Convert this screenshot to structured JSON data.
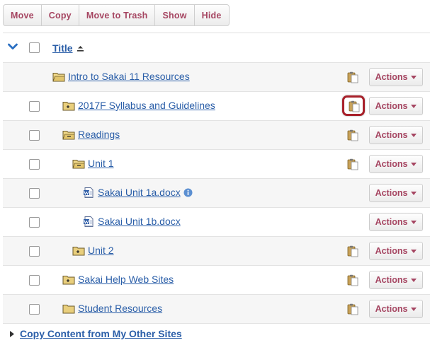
{
  "toolbar": {
    "buttons": [
      "Move",
      "Copy",
      "Move to Trash",
      "Show",
      "Hide"
    ]
  },
  "header": {
    "title_label": "Title"
  },
  "rows": [
    {
      "name": "Intro to Sakai 11 Resources",
      "icon": "folder-open-icon",
      "indent": 0,
      "has_checkbox": false,
      "has_clipboard": true,
      "actions": "Actions"
    },
    {
      "name": "2017F Syllabus and Guidelines",
      "icon": "folder-plus-icon",
      "indent": 1,
      "has_checkbox": true,
      "has_clipboard": true,
      "clipboard_highlighted": true,
      "actions": "Actions"
    },
    {
      "name": "Readings",
      "icon": "folder-minus-icon",
      "indent": 1,
      "has_checkbox": true,
      "has_clipboard": true,
      "actions": "Actions"
    },
    {
      "name": "Unit 1",
      "icon": "folder-minus-icon",
      "indent": 2,
      "has_checkbox": true,
      "has_clipboard": true,
      "actions": "Actions"
    },
    {
      "name": "Sakai Unit 1a.docx",
      "icon": "word-doc-icon",
      "indent": 3,
      "has_checkbox": true,
      "has_clipboard": false,
      "has_info": true,
      "actions": "Actions"
    },
    {
      "name": "Sakai Unit 1b.docx",
      "icon": "word-doc-icon",
      "indent": 3,
      "has_checkbox": true,
      "has_clipboard": false,
      "actions": "Actions"
    },
    {
      "name": "Unit 2",
      "icon": "folder-plus-icon",
      "indent": 2,
      "has_checkbox": true,
      "has_clipboard": true,
      "actions": "Actions"
    },
    {
      "name": "Sakai Help Web Sites",
      "icon": "folder-plus-icon",
      "indent": 1,
      "has_checkbox": true,
      "has_clipboard": true,
      "actions": "Actions"
    },
    {
      "name": "Student Resources",
      "icon": "folder-icon",
      "indent": 1,
      "has_checkbox": true,
      "has_clipboard": true,
      "actions": "Actions"
    }
  ],
  "footer": {
    "link_label": "Copy Content from My Other Sites"
  },
  "colors": {
    "link": "#2a5ea8",
    "button_text": "#a64662",
    "highlight": "#a8202a",
    "folder": "#e9cf7d"
  }
}
